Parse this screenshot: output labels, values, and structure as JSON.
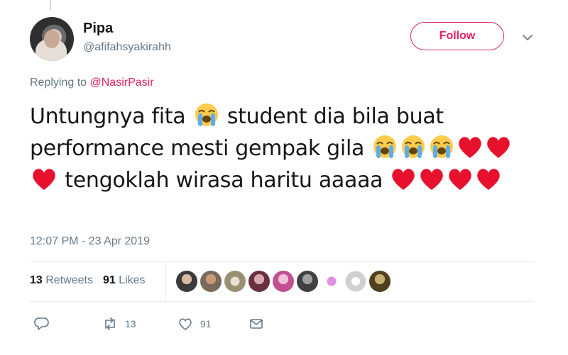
{
  "user": {
    "name": "Pipa",
    "handle": "@afifahsyakirahh"
  },
  "follow_button": {
    "label": "Follow"
  },
  "reply": {
    "prefix": "Replying to ",
    "mention": "@NasirPasir"
  },
  "tweet": {
    "segment1": "Untungnya fita ",
    "segment2": " student dia bila buat performance mesti gempak gila ",
    "segment3": " tengoklah wirasa haritu aaaaa "
  },
  "timestamp": "12:07 PM - 23 Apr 2019",
  "stats": {
    "retweets_count": "13",
    "retweets_label": "Retweets",
    "likes_count": "91",
    "likes_label": "Likes"
  },
  "actions": {
    "retweet_count": "13",
    "like_count": "91"
  },
  "colors": {
    "accent": "#e0245e",
    "secondary_text": "#657786",
    "divider": "#e6ecf0"
  },
  "icons": [
    "chevron-down-icon",
    "crying-face-emoji",
    "red-heart-emoji",
    "reply-icon",
    "retweet-icon",
    "like-icon",
    "message-icon"
  ]
}
